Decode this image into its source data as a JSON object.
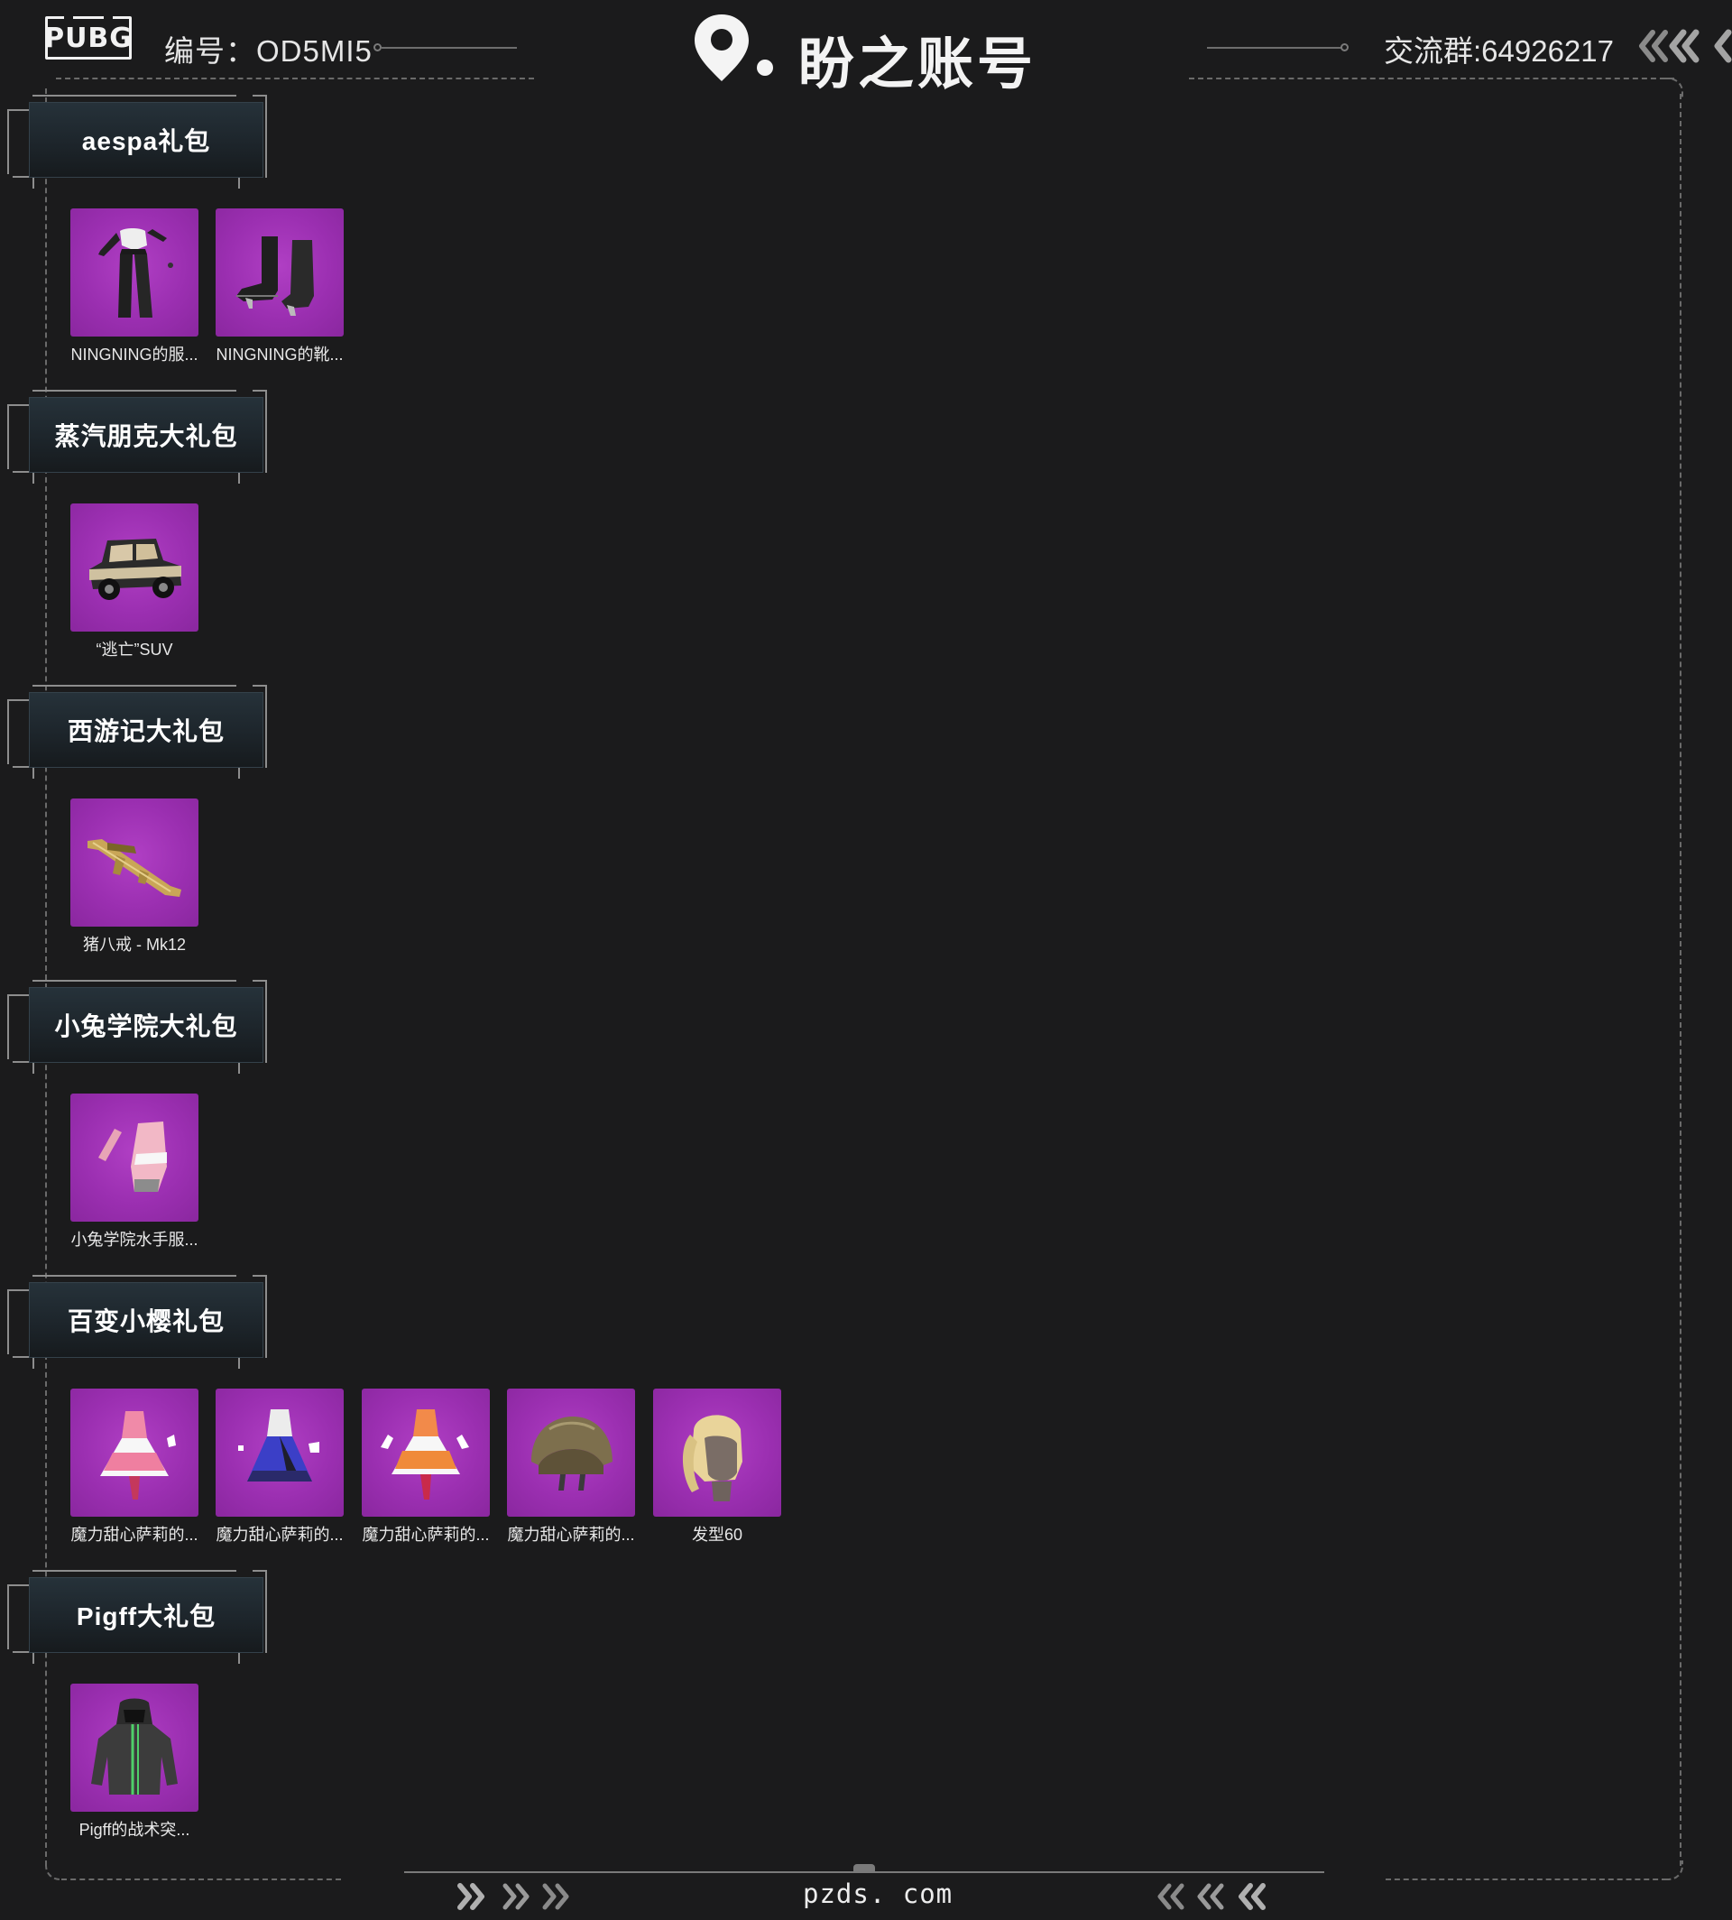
{
  "header": {
    "game_logo": "PUBG",
    "account_id": "编号：OD5MI5",
    "brand_name": "盼之账号",
    "group_number": "交流群:64926217"
  },
  "sections": [
    {
      "title": "aespa礼包",
      "items": [
        {
          "name": "NINGNING的服...",
          "icon": "outfit-icon"
        },
        {
          "name": "NINGNING的靴...",
          "icon": "boots-icon"
        }
      ]
    },
    {
      "title": "蒸汽朋克大礼包",
      "items": [
        {
          "name": "“逃亡”SUV",
          "icon": "vintage-car-icon"
        }
      ]
    },
    {
      "title": "西游记大礼包",
      "items": [
        {
          "name": "猪八戒 - Mk12",
          "icon": "rifle-icon"
        }
      ]
    },
    {
      "title": "小兔学院大礼包",
      "items": [
        {
          "name": "小兔学院水手服...",
          "icon": "gloves-icon"
        }
      ]
    },
    {
      "title": "百变小樱礼包",
      "items": [
        {
          "name": "魔力甜心萨莉的...",
          "icon": "pink-dress-icon"
        },
        {
          "name": "魔力甜心萨莉的...",
          "icon": "blue-dress-icon"
        },
        {
          "name": "魔力甜心萨莉的...",
          "icon": "orange-dress-icon"
        },
        {
          "name": "魔力甜心萨莉的...",
          "icon": "helmet-icon"
        },
        {
          "name": "发型60",
          "icon": "ponytail-hair-icon"
        }
      ]
    },
    {
      "title": "Pigff大礼包",
      "items": [
        {
          "name": "Pigff的战术突...",
          "icon": "hoodie-icon"
        }
      ]
    }
  ],
  "footer": {
    "site": "pzds. com"
  },
  "colors": {
    "background": "#1b1b1c",
    "item_bg": "#9b2fb1",
    "plate_bg": "#1d252b",
    "frame": "#6a6a6a"
  }
}
